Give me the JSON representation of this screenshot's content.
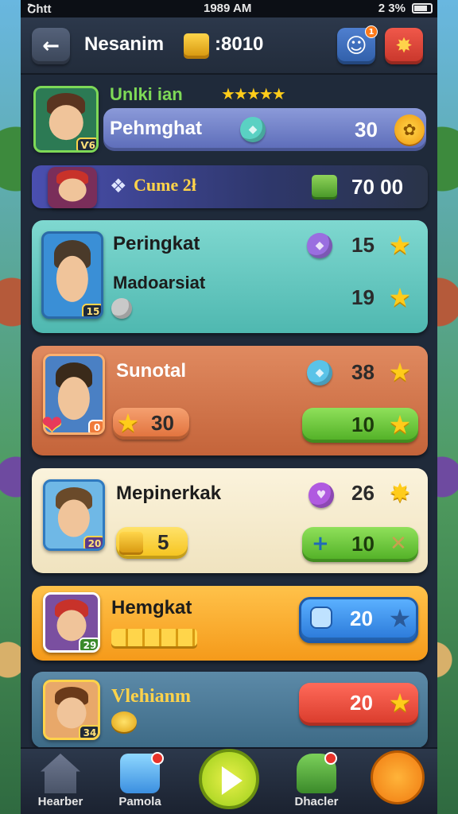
{
  "status_bar": {
    "carrier": "Շhtt",
    "time": "1989 AM",
    "battery": "2 3%"
  },
  "header": {
    "title": "Nesanim",
    "gold": ":8010",
    "profile_badge": "1"
  },
  "profile_card": {
    "subtitle": "Unlki ian",
    "stars": "★★★★★",
    "bar_name": "Pehmghat",
    "level": "Ѵ6",
    "value": "30"
  },
  "banner": {
    "label": "Cume 2ł",
    "value": "70 00"
  },
  "rank_cards": [
    {
      "name": "Peringkat",
      "sub": "Madoarsiat",
      "level": "15",
      "value1": "15",
      "value2": "19"
    },
    {
      "name": "Sunotal",
      "pill": "30",
      "value1": "38",
      "value2": "10",
      "tag": "0"
    },
    {
      "name": "Mepinerkak",
      "pill": "5",
      "level": "20",
      "value1": "26",
      "value2": "10"
    },
    {
      "name": "Hemgkat",
      "level": "29",
      "value": "20"
    },
    {
      "name": "Vlehianm",
      "level": "34",
      "value": "20"
    }
  ],
  "bottom_nav": [
    {
      "label": "Hearber",
      "icon": "house-icon"
    },
    {
      "label": "Pamola",
      "icon": "gem-icon"
    },
    {
      "label": "",
      "icon": "play-icon"
    },
    {
      "label": "Dhacler",
      "icon": "monster-icon"
    },
    {
      "label": "",
      "icon": "fox-icon"
    }
  ]
}
